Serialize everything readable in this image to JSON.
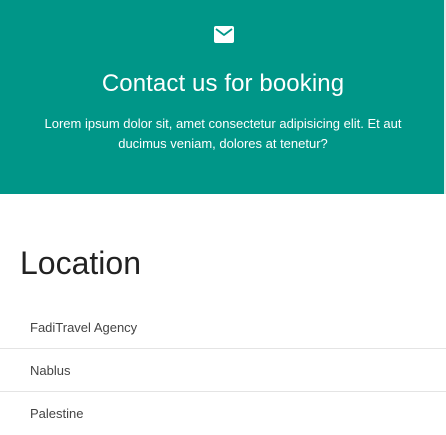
{
  "hero": {
    "icon": "envelope-icon",
    "title": "Contact us for booking",
    "text": "Lorem ipsum dolor sit, amet consectetur adipisicing elit. Et aut ducimus veniam, dolores at tenetur?",
    "background_color": "#009688"
  },
  "location": {
    "title": "Location",
    "items": [
      {
        "label": "FadiTravel Agency"
      },
      {
        "label": "Nablus"
      },
      {
        "label": "Palestine"
      }
    ]
  }
}
